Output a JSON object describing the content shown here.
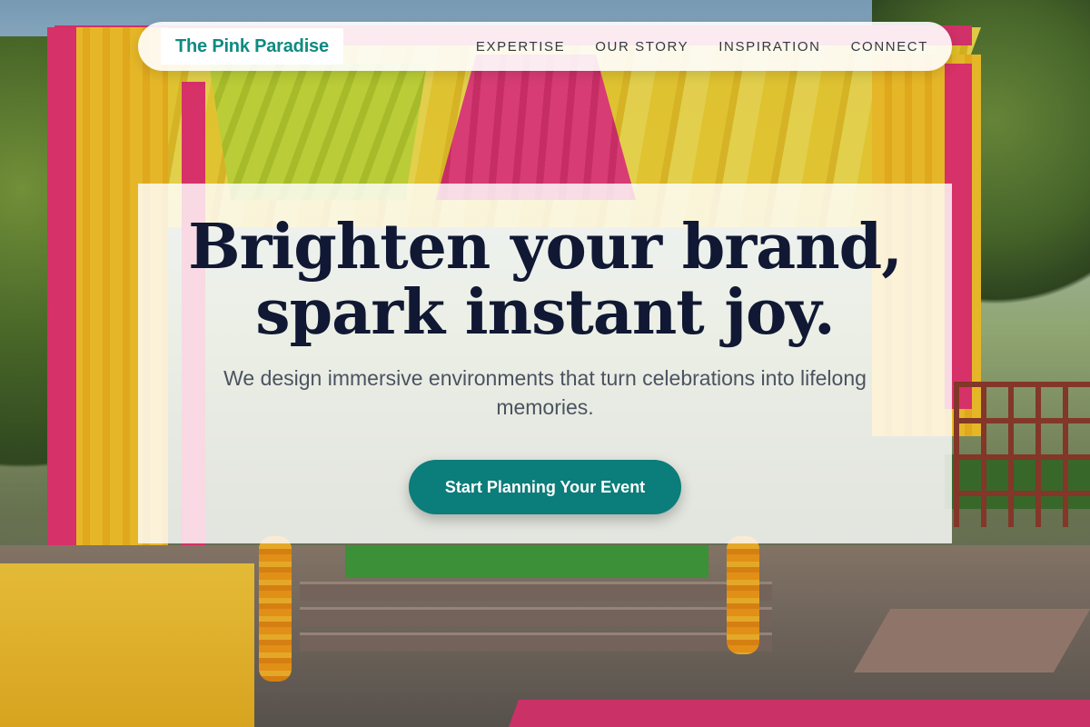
{
  "brand": {
    "name": "The Pink Paradise",
    "accent_color": "#0f8a82"
  },
  "nav": {
    "items": [
      {
        "label": "EXPERTISE"
      },
      {
        "label": "OUR STORY"
      },
      {
        "label": "INSPIRATION"
      },
      {
        "label": "CONNECT"
      }
    ]
  },
  "hero": {
    "headline_line1": "Brighten your brand,",
    "headline_line2": "spark instant joy.",
    "subtitle": "We design immersive environments that turn celebrations into lifelong memories.",
    "cta_label": "Start Planning Your Event",
    "cta_color": "#0b7d7a",
    "headline_color": "#111833"
  },
  "background": {
    "image_subject": "colorful-wedding-mandap-photo"
  }
}
